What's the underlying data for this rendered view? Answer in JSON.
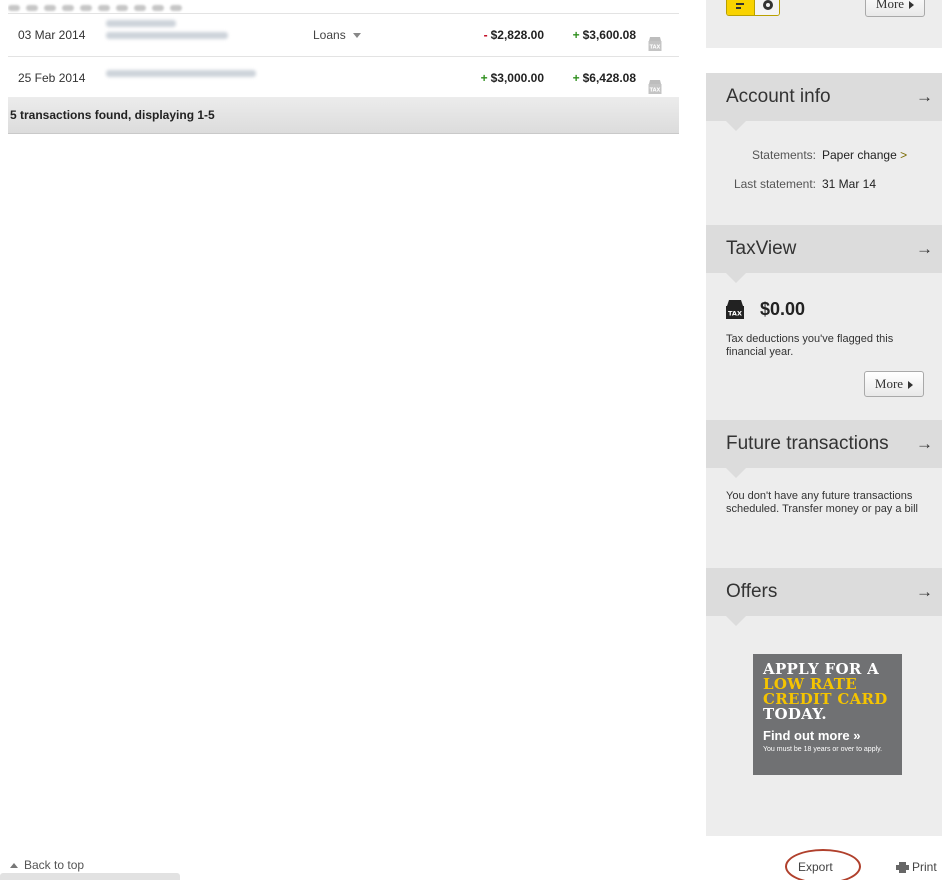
{
  "transactions": {
    "rows": [
      {
        "date": "03 Mar 2014",
        "category": "Loans",
        "amount_sign": "-",
        "amount": "$2,828.00",
        "balance_sign": "+",
        "balance": "$3,600.08"
      },
      {
        "date": "25 Feb 2014",
        "category": "",
        "amount_sign": "+",
        "amount": "$3,000.00",
        "balance_sign": "+",
        "balance": "$6,428.08"
      }
    ],
    "footer": "5 transactions found, displaying 1-5"
  },
  "sidebar": {
    "top_widget": {
      "more_label": "More"
    },
    "account_info": {
      "title": "Account info",
      "statements_label": "Statements:",
      "statements_value": "Paper",
      "change_label": "change",
      "change_suffix": ">",
      "last_statement_label": "Last statement:",
      "last_statement_value": "31 Mar 14"
    },
    "taxview": {
      "title": "TaxView",
      "amount": "$0.00",
      "description": "Tax deductions you've flagged this financial year.",
      "more_label": "More"
    },
    "future": {
      "title": "Future transactions",
      "text": "You don't have any future transactions scheduled. Transfer money or pay a bill"
    },
    "offers": {
      "title": "Offers",
      "promo": {
        "line1": "APPLY FOR A",
        "line2": "LOW RATE",
        "line3": "CREDIT CARD",
        "line4": "TODAY.",
        "cta": "Find out more »",
        "disclaimer": "You must be 18 years or over to apply."
      }
    },
    "arrow_glyph": "→"
  },
  "bottom": {
    "back_to_top": "Back to top",
    "export": "Export",
    "print": "Print"
  },
  "colors": {
    "negative": "#c0001a",
    "positive": "#2f8f1e",
    "brand_yellow": "#f9d300",
    "sidebar_bg": "#ededed",
    "annotation_circle": "#b0402c"
  }
}
